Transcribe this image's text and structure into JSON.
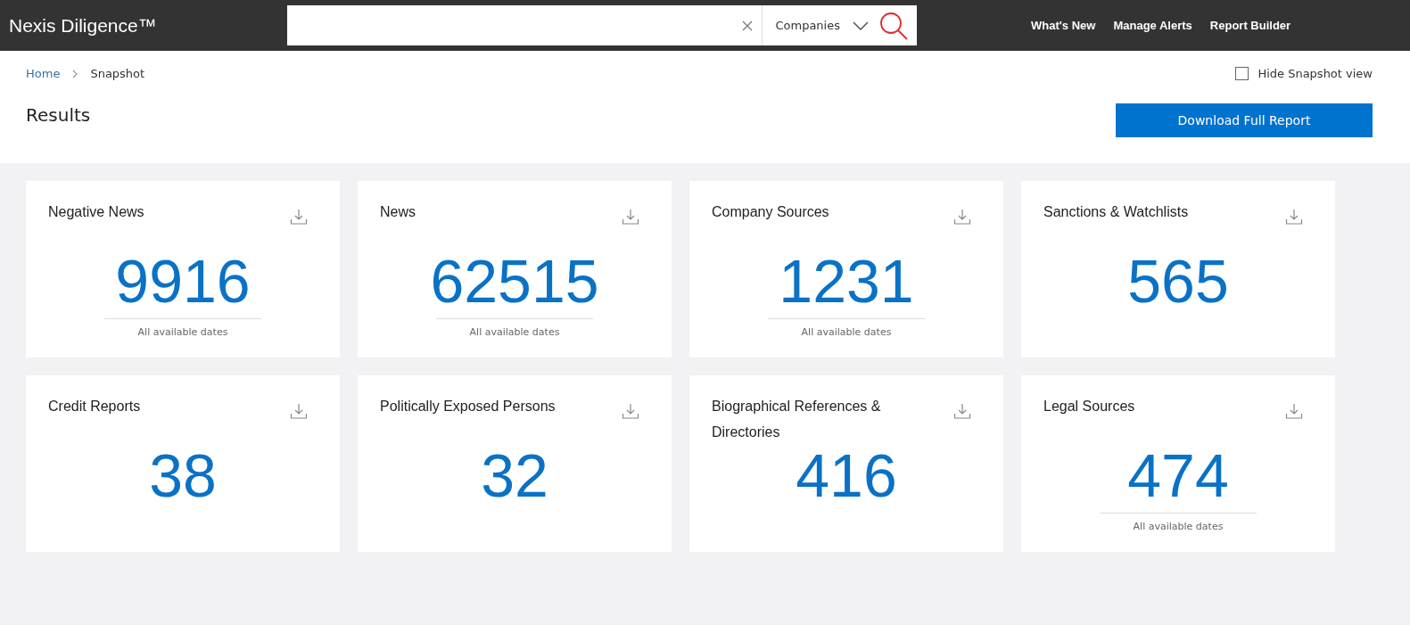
{
  "header": {
    "logo": "Nexis Diligence™",
    "search": {
      "category": "Companies"
    },
    "nav": [
      "What's New",
      "Manage Alerts",
      "Report Builder"
    ]
  },
  "breadcrumb": [
    "Home",
    "Snapshot"
  ],
  "hide_snapshot": {
    "label": "Hide Snapshot view",
    "checked": false
  },
  "title": "Results",
  "download_button": "Download Full Report",
  "cards": [
    {
      "title": "Negative News",
      "count": "9916",
      "caption": "All available dates"
    },
    {
      "title": "News",
      "count": "62515",
      "caption": "All available dates"
    },
    {
      "title": "Company Sources",
      "count": "1231",
      "caption": "All available dates"
    },
    {
      "title": "Sanctions & Watchlists",
      "count": "565"
    },
    {
      "title": "Credit Reports",
      "count": "38"
    },
    {
      "title": "Politically Exposed Persons",
      "count": "32"
    },
    {
      "title": "Biographical References & Directories",
      "count": "416"
    },
    {
      "title": "Legal Sources",
      "count": "474",
      "caption": "All available dates"
    }
  ]
}
